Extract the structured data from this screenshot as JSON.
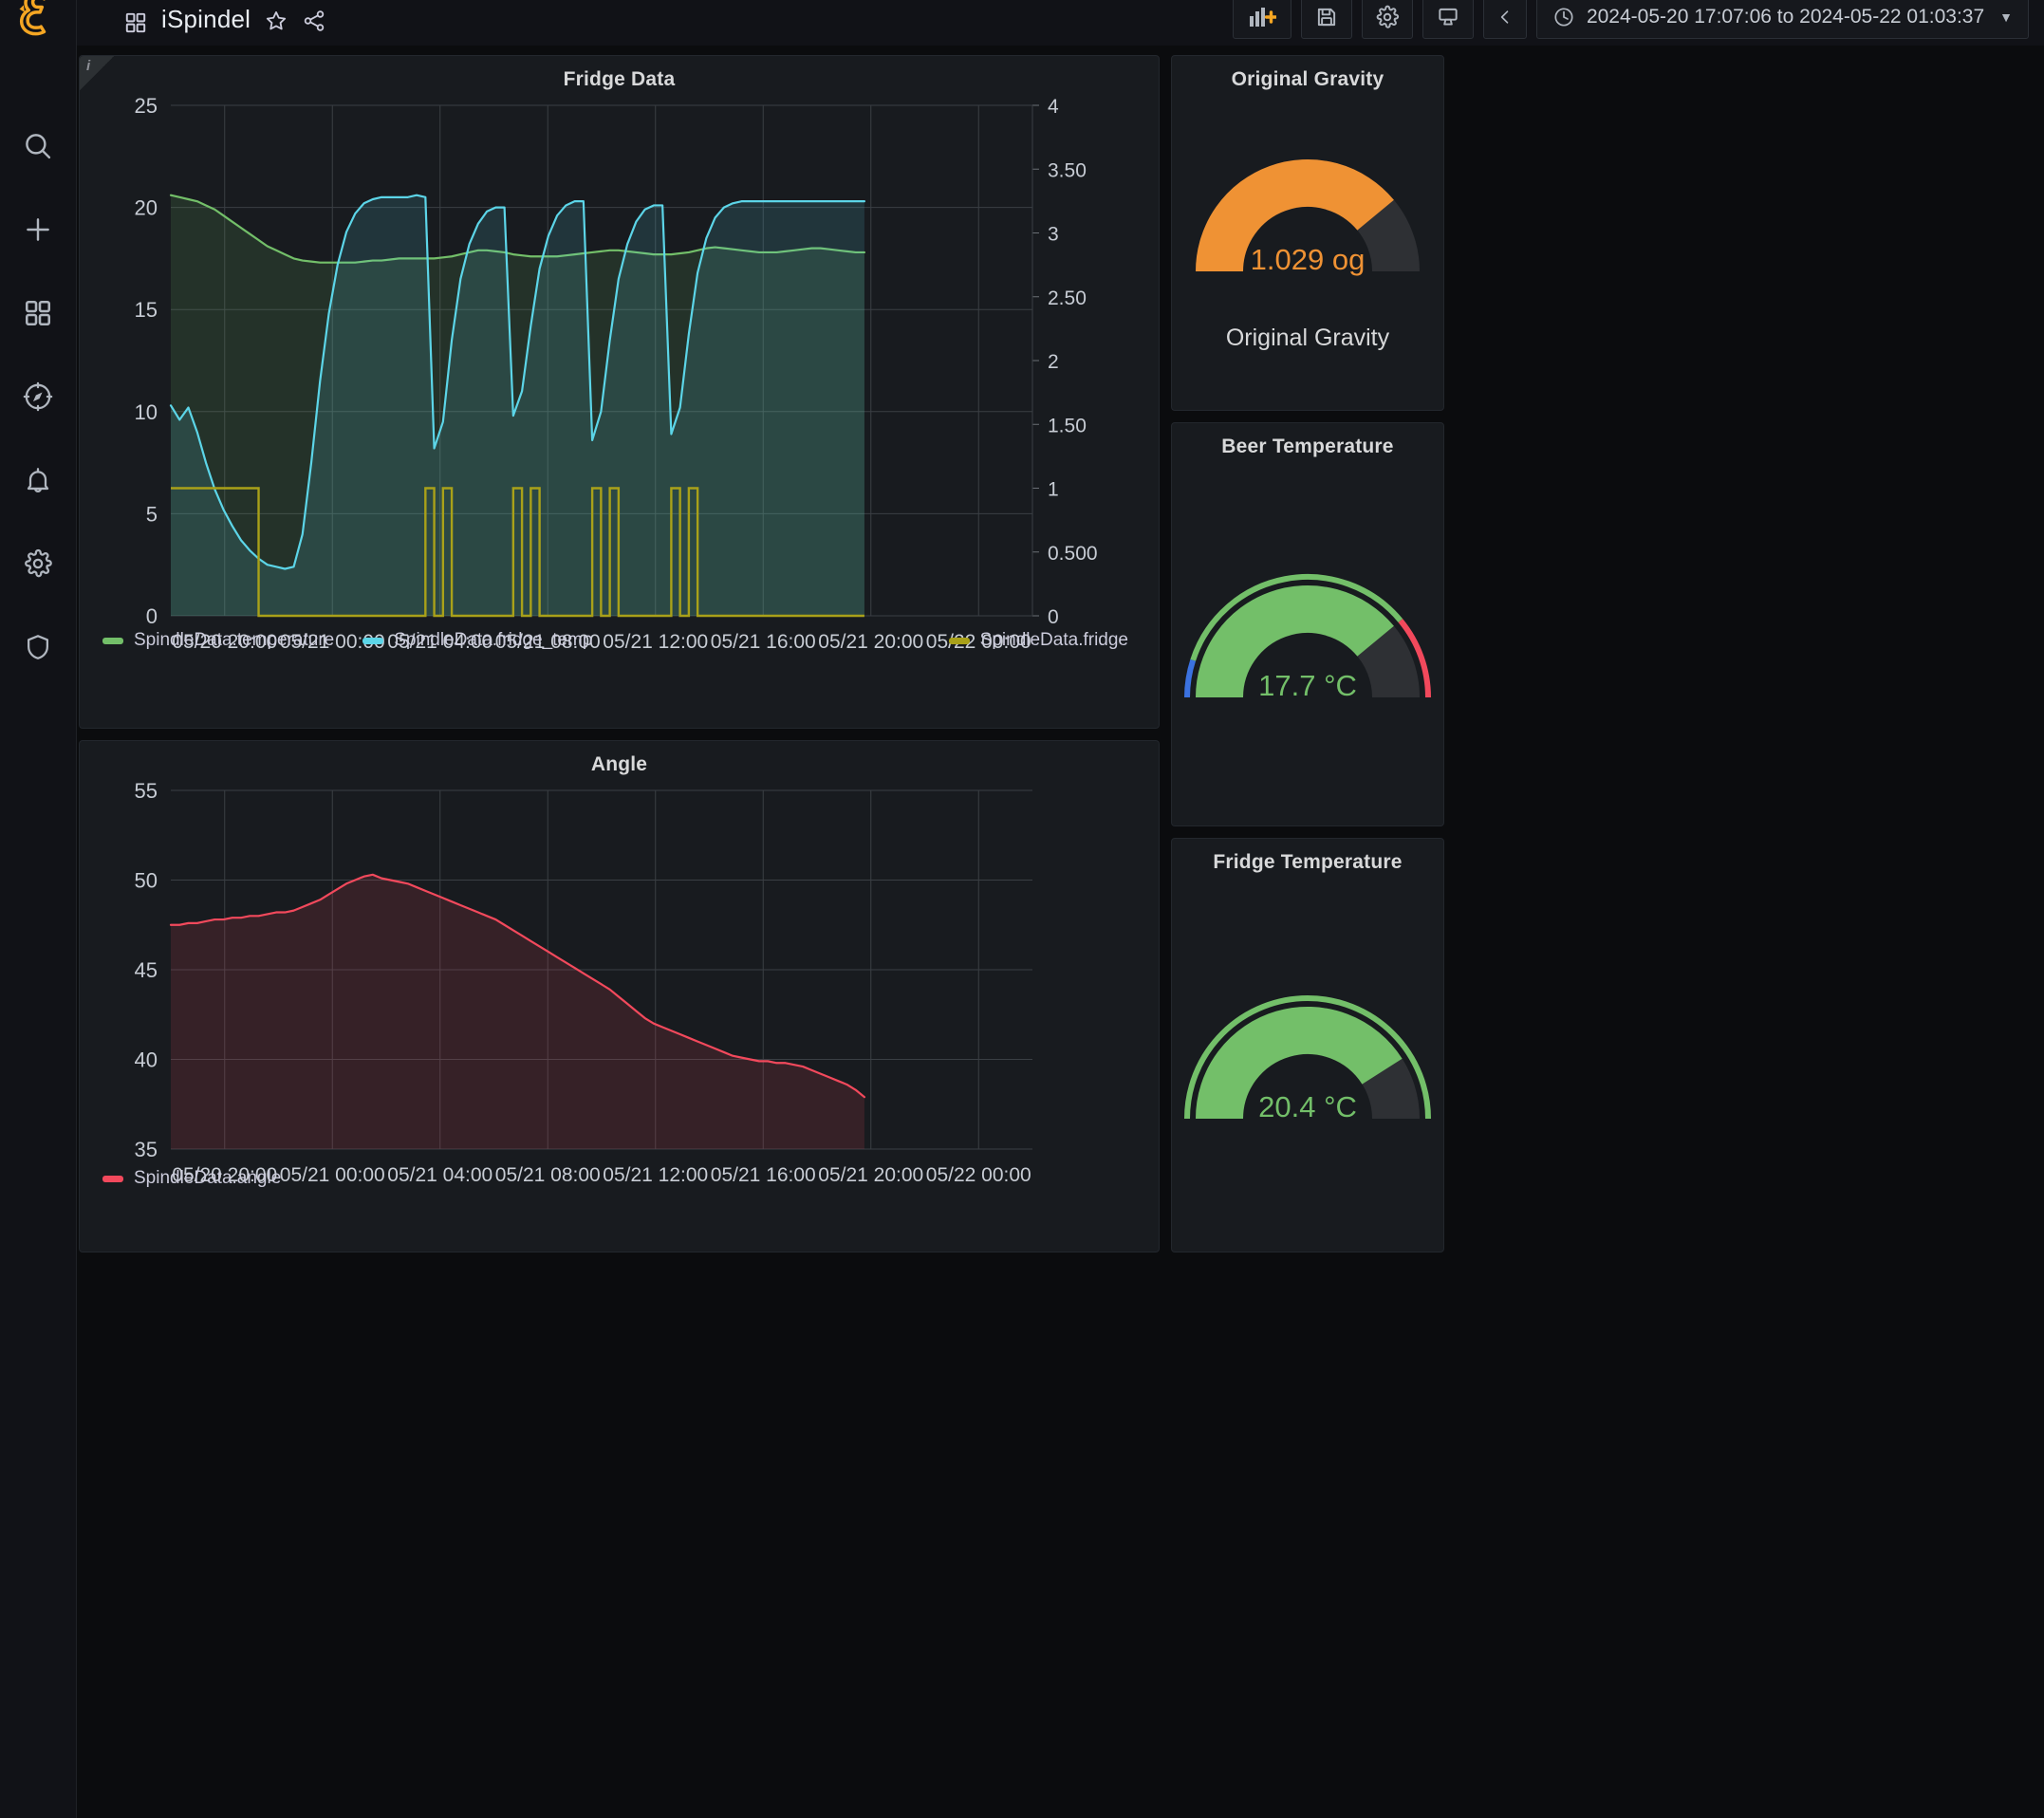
{
  "app": {
    "brand_icon": "grafana-logo-icon"
  },
  "sidebar": {
    "items": [
      {
        "name": "search-icon",
        "label": "Search"
      },
      {
        "name": "plus-icon",
        "label": "Create"
      },
      {
        "name": "dashboards-icon",
        "label": "Dashboards"
      },
      {
        "name": "compass-icon",
        "label": "Explore"
      },
      {
        "name": "bell-icon",
        "label": "Alerting"
      },
      {
        "name": "gear-icon",
        "label": "Configuration"
      },
      {
        "name": "shield-icon",
        "label": "Server Admin"
      }
    ]
  },
  "header": {
    "title": "iSpindel",
    "star_label": "Mark as favorite",
    "share_label": "Share dashboard",
    "buttons": [
      {
        "name": "add-panel-button",
        "label": "Add panel"
      },
      {
        "name": "save-dashboard-button",
        "label": "Save dashboard"
      },
      {
        "name": "dashboard-settings-button",
        "label": "Dashboard settings"
      },
      {
        "name": "cycle-view-mode-button",
        "label": "Cycle view mode"
      }
    ],
    "time_range": "2024-05-20 17:07:06 to 2024-05-22 01:03:37",
    "zoom_out_label": "<",
    "chevron": "⌄"
  },
  "chart_data": [
    {
      "id": "fridge_data",
      "type": "line",
      "title": "Fridge Data",
      "xlabel": "",
      "ylabel": "",
      "grid": true,
      "legend_position": "bottom",
      "x_ticks": [
        "05/20 20:00",
        "05/21 00:00",
        "05/21 04:00",
        "05/21 08:00",
        "05/21 12:00",
        "05/21 16:00",
        "05/21 20:00",
        "05/22 00:00"
      ],
      "y_left_ticks": [
        "25",
        "20",
        "15",
        "10",
        "5",
        "0"
      ],
      "y_left_lim": [
        0,
        25
      ],
      "y_right_ticks": [
        "4",
        "3.50",
        "3",
        "2.50",
        "2",
        "1.50",
        "1",
        "0.500",
        "0"
      ],
      "y_right_lim": [
        0,
        4
      ],
      "series": [
        {
          "name": "SpindleData.temperature",
          "color": "#73bf69",
          "axis": "left",
          "values": [
            20.6,
            20.5,
            20.4,
            20.3,
            20.1,
            19.9,
            19.6,
            19.3,
            19.0,
            18.7,
            18.4,
            18.1,
            17.9,
            17.7,
            17.5,
            17.4,
            17.35,
            17.3,
            17.3,
            17.3,
            17.3,
            17.3,
            17.35,
            17.4,
            17.4,
            17.45,
            17.5,
            17.5,
            17.5,
            17.5,
            17.5,
            17.55,
            17.6,
            17.7,
            17.8,
            17.9,
            17.9,
            17.85,
            17.8,
            17.7,
            17.65,
            17.6,
            17.6,
            17.6,
            17.6,
            17.65,
            17.7,
            17.75,
            17.8,
            17.85,
            17.9,
            17.9,
            17.85,
            17.8,
            17.75,
            17.7,
            17.7,
            17.7,
            17.75,
            17.8,
            17.9,
            18.0,
            18.05,
            18.0,
            17.95,
            17.9,
            17.85,
            17.8,
            17.8,
            17.8,
            17.85,
            17.9,
            17.95,
            18.0,
            18.0,
            17.95,
            17.9,
            17.85,
            17.8,
            17.8
          ]
        },
        {
          "name": "SpindleData.fridge_temp",
          "color": "#5cd5e8",
          "axis": "left",
          "values": [
            10.3,
            9.6,
            10.2,
            9.0,
            7.5,
            6.2,
            5.2,
            4.4,
            3.7,
            3.2,
            2.8,
            2.5,
            2.4,
            2.3,
            2.4,
            4.0,
            7.5,
            11.5,
            14.8,
            17.2,
            18.8,
            19.7,
            20.2,
            20.4,
            20.5,
            20.5,
            20.5,
            20.5,
            20.6,
            20.5,
            8.2,
            9.5,
            13.5,
            16.5,
            18.2,
            19.2,
            19.8,
            20.0,
            20.0,
            9.8,
            11.0,
            14.2,
            17.0,
            18.6,
            19.6,
            20.1,
            20.3,
            20.3,
            8.6,
            10.0,
            13.5,
            16.5,
            18.2,
            19.3,
            19.9,
            20.1,
            20.1,
            8.9,
            10.2,
            13.8,
            16.8,
            18.5,
            19.5,
            20.0,
            20.2,
            20.3,
            20.3,
            20.3,
            20.3,
            20.3,
            20.3,
            20.3,
            20.3,
            20.3,
            20.3,
            20.3,
            20.3,
            20.3,
            20.3,
            20.3
          ]
        },
        {
          "name": "SpindleData.fridge",
          "color": "#a9a119",
          "axis": "right",
          "values": [
            1,
            1,
            1,
            1,
            1,
            1,
            1,
            1,
            1,
            1,
            0,
            0,
            0,
            0,
            0,
            0,
            0,
            0,
            0,
            0,
            0,
            0,
            0,
            0,
            0,
            0,
            0,
            0,
            0,
            1,
            0,
            1,
            0,
            0,
            0,
            0,
            0,
            0,
            0,
            1,
            0,
            1,
            0,
            0,
            0,
            0,
            0,
            0,
            1,
            0,
            1,
            0,
            0,
            0,
            0,
            0,
            0,
            1,
            0,
            1,
            0,
            0,
            0,
            0,
            0,
            0,
            0,
            0,
            0,
            0,
            0,
            0,
            0,
            0,
            0,
            0,
            0,
            0,
            0,
            0
          ]
        }
      ]
    },
    {
      "id": "angle",
      "type": "line",
      "title": "Angle",
      "xlabel": "",
      "ylabel": "",
      "grid": true,
      "legend_position": "bottom",
      "x_ticks": [
        "05/20 20:00",
        "05/21 00:00",
        "05/21 04:00",
        "05/21 08:00",
        "05/21 12:00",
        "05/21 16:00",
        "05/21 20:00",
        "05/22 00:00"
      ],
      "y_left_ticks": [
        "55",
        "50",
        "45",
        "40",
        "35"
      ],
      "y_left_lim": [
        35,
        55
      ],
      "series": [
        {
          "name": "SpindleData.angle",
          "color": "#f2495c",
          "axis": "left",
          "values": [
            47.5,
            47.5,
            47.6,
            47.6,
            47.7,
            47.8,
            47.8,
            47.9,
            47.9,
            48.0,
            48.0,
            48.1,
            48.2,
            48.2,
            48.3,
            48.5,
            48.7,
            48.9,
            49.2,
            49.5,
            49.8,
            50.0,
            50.2,
            50.3,
            50.1,
            50.0,
            49.9,
            49.8,
            49.6,
            49.4,
            49.2,
            49.0,
            48.8,
            48.6,
            48.4,
            48.2,
            48.0,
            47.8,
            47.5,
            47.2,
            46.9,
            46.6,
            46.3,
            46.0,
            45.7,
            45.4,
            45.1,
            44.8,
            44.5,
            44.2,
            43.9,
            43.5,
            43.1,
            42.7,
            42.3,
            42.0,
            41.8,
            41.6,
            41.4,
            41.2,
            41.0,
            40.8,
            40.6,
            40.4,
            40.2,
            40.1,
            40.0,
            39.9,
            39.9,
            39.8,
            39.8,
            39.7,
            39.6,
            39.4,
            39.2,
            39.0,
            38.8,
            38.6,
            38.3,
            37.9
          ]
        }
      ]
    }
  ],
  "panels": {
    "fridge_data": {
      "title": "Fridge Data",
      "info_icon": "info-icon"
    },
    "angle": {
      "title": "Angle"
    },
    "original_gravity": {
      "title": "Original Gravity",
      "value": "1.029 og",
      "label": "Original Gravity",
      "color": "#ef9234",
      "percent": 78
    },
    "beer_temperature": {
      "title": "Beer Temperature",
      "value": "17.7 °C",
      "color": "#73bf69",
      "percent": 78,
      "threshold_colors": [
        "#3b72e0",
        "#73bf69",
        "#f2495c"
      ]
    },
    "fridge_temperature": {
      "title": "Fridge Temperature",
      "value": "20.4 °C",
      "color": "#73bf69",
      "percent": 82,
      "threshold_colors": [
        "#73bf69"
      ]
    }
  }
}
